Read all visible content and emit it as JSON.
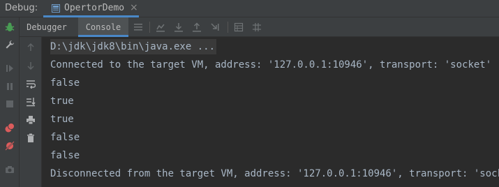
{
  "titlebar": {
    "debug_label": "Debug:",
    "run_tab_label": "OpertorDemo",
    "run_tab_close": "×"
  },
  "subtoolbar": {
    "tabs": [
      {
        "label": "Debugger",
        "active": false
      },
      {
        "label": "Console",
        "active": true
      }
    ]
  },
  "console": {
    "lines": [
      "D:\\jdk\\jdk8\\bin\\java.exe ...",
      "Connected to the target VM, address: '127.0.0.1:10946', transport: 'socket'",
      "false",
      "true",
      "true",
      "false",
      "false",
      "Disconnected from the target VM, address: '127.0.0.1:10946', transport: 'socket'"
    ]
  },
  "icons": {
    "debug_bug": "bug-icon",
    "settings": "wrench-icon",
    "resume": "resume-icon",
    "pause": "pause-icon",
    "stop": "stop-icon",
    "view_breakpoints": "breakpoints-icon",
    "mute_breakpoints": "mute-breakpoints-icon",
    "camera": "camera-icon"
  },
  "colors": {
    "accent": "#4a88c7",
    "console_bg": "#2b2b2b",
    "panel_bg": "#3c3f41",
    "text": "#a9b7c6",
    "bug_green": "#499c54",
    "breakpoint_red": "#db5c5c"
  }
}
